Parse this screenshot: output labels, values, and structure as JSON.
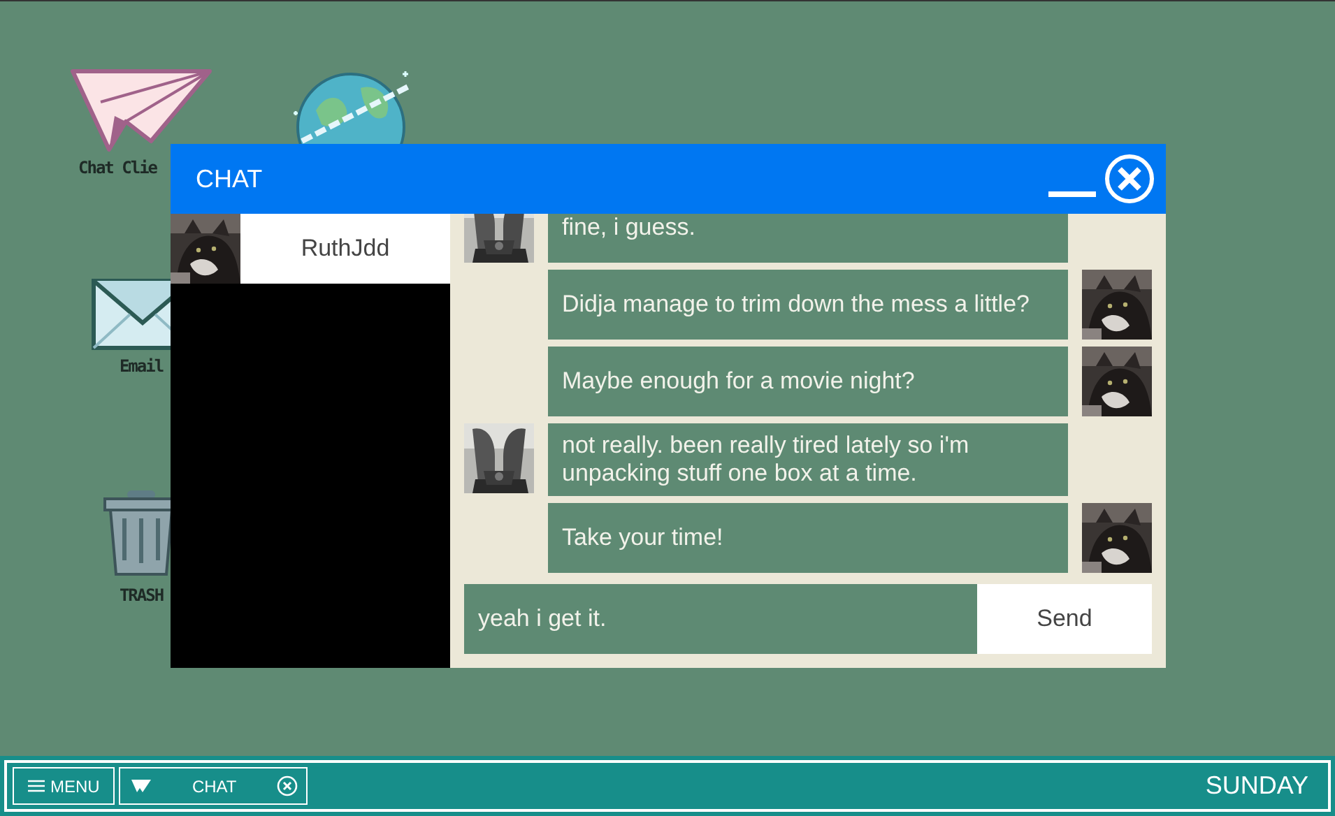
{
  "desktop_icons": [
    {
      "kind": "plane",
      "label": "Chat Clie"
    },
    {
      "kind": "globe"
    },
    {
      "kind": "mail",
      "label": "Email"
    },
    {
      "kind": "trash",
      "label": "TRASH"
    }
  ],
  "chat_window": {
    "title": "CHAT",
    "contacts": [
      {
        "name": "RuthJdd",
        "selected": true
      }
    ],
    "messages": [
      {
        "kind": "incoming",
        "text": "fine, i guess."
      },
      {
        "kind": "outgoing",
        "text": "Didja manage to trim down the mess a little?"
      },
      {
        "kind": "outgoing",
        "text": "Maybe enough for a movie night?"
      },
      {
        "kind": "incoming",
        "text": "not really. been really tired lately so i'm unpacking stuff one box at a time."
      },
      {
        "kind": "outgoing",
        "text": "Take your time!"
      }
    ],
    "input": {
      "value": "yeah i get it."
    },
    "send_button": "Send"
  },
  "taskbar": {
    "menu": "MENU",
    "tasks": [
      {
        "label": "CHAT"
      }
    ],
    "day": "SUNDAY"
  }
}
